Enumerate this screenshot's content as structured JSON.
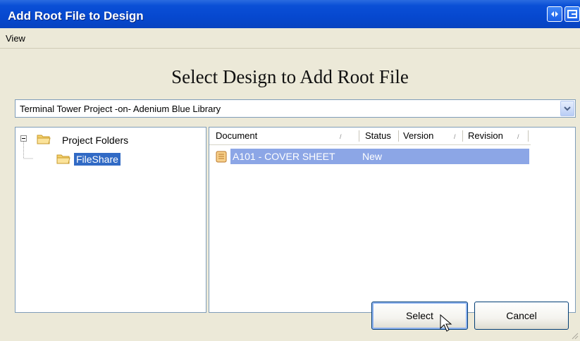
{
  "window": {
    "title": "Add Root File to Design",
    "colors": {
      "titlebar": "#0648cf",
      "selection": "#316AC5",
      "row_highlight": "#8ca6e6",
      "face": "#ECE9D8"
    }
  },
  "menu": {
    "items": [
      "View"
    ]
  },
  "heading": "Select Design to Add Root File",
  "design_combo": {
    "selected": "Terminal Tower Project -on- Adenium Blue Library"
  },
  "tree": {
    "root": {
      "label": "Project Folders",
      "expanded": true
    },
    "child": {
      "label": "FileShare",
      "selected": true
    }
  },
  "list": {
    "columns": [
      "Document",
      "Status",
      "Version",
      "Revision"
    ],
    "rows": [
      {
        "document": "A101 - COVER SHEET",
        "status": "New",
        "version": "",
        "revision": ""
      }
    ]
  },
  "buttons": {
    "select": "Select",
    "cancel": "Cancel"
  },
  "icons": [
    "restore-icon",
    "close-icon",
    "dropdown-arrow-icon",
    "folder-icon",
    "document-icon",
    "mouse-cursor-icon"
  ]
}
